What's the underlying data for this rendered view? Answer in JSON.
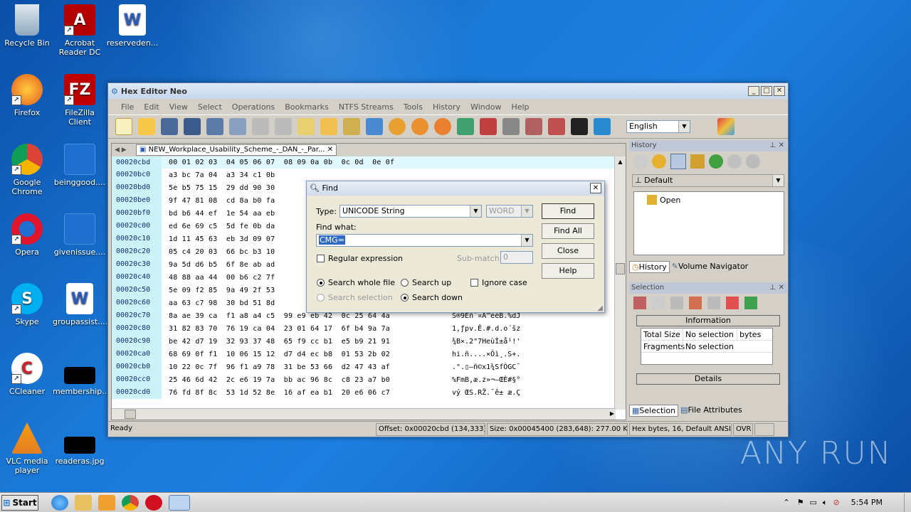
{
  "desktop": {
    "icons": [
      {
        "label": "Recycle Bin",
        "icon": "recycle-bin-icon"
      },
      {
        "label": "Acrobat Reader DC",
        "icon": "acrobat-icon"
      },
      {
        "label": "reserveden...",
        "icon": "word-doc-icon"
      },
      {
        "label": "Firefox",
        "icon": "firefox-icon"
      },
      {
        "label": "FileZilla Client",
        "icon": "filezilla-icon"
      },
      {
        "label": "Google Chrome",
        "icon": "chrome-icon"
      },
      {
        "label": "beinggood....",
        "icon": "file-icon"
      },
      {
        "label": "Opera",
        "icon": "opera-icon"
      },
      {
        "label": "givenissue....",
        "icon": "file-icon"
      },
      {
        "label": "Skype",
        "icon": "skype-icon"
      },
      {
        "label": "groupassist....",
        "icon": "word-doc-icon"
      },
      {
        "label": "CCleaner",
        "icon": "ccleaner-icon"
      },
      {
        "label": "membership....",
        "icon": "black-file-icon"
      },
      {
        "label": "VLC media player",
        "icon": "vlc-icon"
      },
      {
        "label": "readeras.jpg",
        "icon": "black-file-icon"
      }
    ]
  },
  "window": {
    "title": "Hex Editor Neo",
    "menu": [
      "File",
      "Edit",
      "View",
      "Select",
      "Operations",
      "Bookmarks",
      "NTFS Streams",
      "Tools",
      "History",
      "Window",
      "Help"
    ],
    "language": "English",
    "tab": "NEW_Workplace_Usability_Scheme_-_DAN_-_Par...",
    "hex_header": "00020cbd",
    "columns": "00 01 02 03  04 05 06 07  08 09 0a 0b  0c 0d  0e 0f",
    "rows": [
      {
        "addr": "00020bc0",
        "bytes": "a3 bc 7a 04  a3 34 c1 0b",
        "ascii": ""
      },
      {
        "addr": "00020bd0",
        "bytes": "5e b5 75 15  29 dd 90 30",
        "ascii": ""
      },
      {
        "addr": "00020be0",
        "bytes": "9f 47 81 08  cd 8a b0 fa",
        "ascii": ""
      },
      {
        "addr": "00020bf0",
        "bytes": "bd b6 44 ef  1e 54 aa eb",
        "ascii": ""
      },
      {
        "addr": "00020c00",
        "bytes": "ed 6e 69 c5  5d fe 0b da",
        "ascii": ""
      },
      {
        "addr": "00020c10",
        "bytes": "1d 11 45 63  eb 3d 09 07",
        "ascii": ""
      },
      {
        "addr": "00020c20",
        "bytes": "05 c4 20 03  66 bc b3 10",
        "ascii": ""
      },
      {
        "addr": "00020c30",
        "bytes": "9a 5d d6 b5  6f 8e ab ad",
        "ascii": ""
      },
      {
        "addr": "00020c40",
        "bytes": "48 88 aa 44  00 b6 c2 7f",
        "ascii": ""
      },
      {
        "addr": "00020c50",
        "bytes": "5e 09 f2 85  9a 49 2f 53",
        "ascii": ""
      },
      {
        "addr": "00020c60",
        "bytes": "aa 63 c7 98  30 bd 51 8d",
        "ascii": ""
      },
      {
        "addr": "00020c70",
        "bytes": "8a ae 39 ca  f1 a8 a4 c5  99 e9 eb 42  0c 25 64 4a",
        "ascii": "Š®9Êñ¨¤Å™éëB.%dJ"
      },
      {
        "addr": "00020c80",
        "bytes": "31 82 83 70  76 19 ca 04  23 01 64 17  6f b4 9a 7a",
        "ascii": "1,ƒpv.Ê.#.d.o´šz"
      },
      {
        "addr": "00020c90",
        "bytes": "be 42 d7 19  32 93 37 48  65 f9 cc b1  e5 b9 21 91",
        "ascii": "¾B×.2\"7HeùÌ±å¹!'"
      },
      {
        "addr": "00020ca0",
        "bytes": "68 69 0f f1  10 06 15 12  d7 d4 ec b8  01 53 2b 02",
        "ascii": "hi.ñ....×Ôì¸.S+."
      },
      {
        "addr": "00020cb0",
        "bytes": "10 22 0c 7f  96 f1 a9 78  31 be 53 66  d2 47 43 af",
        "ascii": ".\".▯–ñ©x1¾SfÒGC¯"
      },
      {
        "addr": "00020cc0",
        "bytes": "25 46 6d 42  2c e6 19 7a  bb ac 96 8c  c8 23 a7 b0",
        "ascii": "%FmB,æ.z»¬–ŒÈ#§°"
      },
      {
        "addr": "00020cd0",
        "bytes": "76 fd 8f 8c  53 1d 52 8e  16 af ea b1  20 e6 06 c7",
        "ascii": "vý ŒS.RŽ.¯ê± æ.Ç"
      }
    ],
    "status": {
      "ready": "Ready",
      "offset": "Offset: 0x00020cbd (134,333)",
      "size": "Size: 0x00045400 (283,648): 277.00 KB",
      "mode": "Hex bytes, 16, Default ANSI",
      "ovr": "OVR"
    }
  },
  "history_panel": {
    "title": "History",
    "group": "Default",
    "item": "Open",
    "tabs": [
      "History",
      "Volume Navigator"
    ]
  },
  "selection_panel": {
    "title": "Selection",
    "info_label": "Information",
    "rows": [
      {
        "k": "Total Size",
        "v": "No selection",
        "u": "bytes"
      },
      {
        "k": "Fragments",
        "v": "No selection",
        "u": ""
      }
    ],
    "details": "Details",
    "tabs": [
      "Selection",
      "File Attributes"
    ]
  },
  "find_dialog": {
    "title": "Find",
    "type_label": "Type:",
    "type_value": "UNICODE String",
    "word_value": "WORD",
    "find_what_label": "Find what:",
    "find_what_value": "CMG=",
    "regex_label": "Regular expression",
    "submatch_label": "Sub-match:",
    "submatch_value": "0",
    "whole_file": "Search whole file",
    "search_up": "Search up",
    "ignore_case": "Ignore case",
    "search_selection": "Search selection",
    "search_down": "Search down",
    "buttons": [
      "Find",
      "Find All",
      "Close",
      "Help"
    ]
  },
  "taskbar": {
    "start": "Start",
    "clock": "5:54 PM"
  },
  "watermark": "ANY RUN"
}
